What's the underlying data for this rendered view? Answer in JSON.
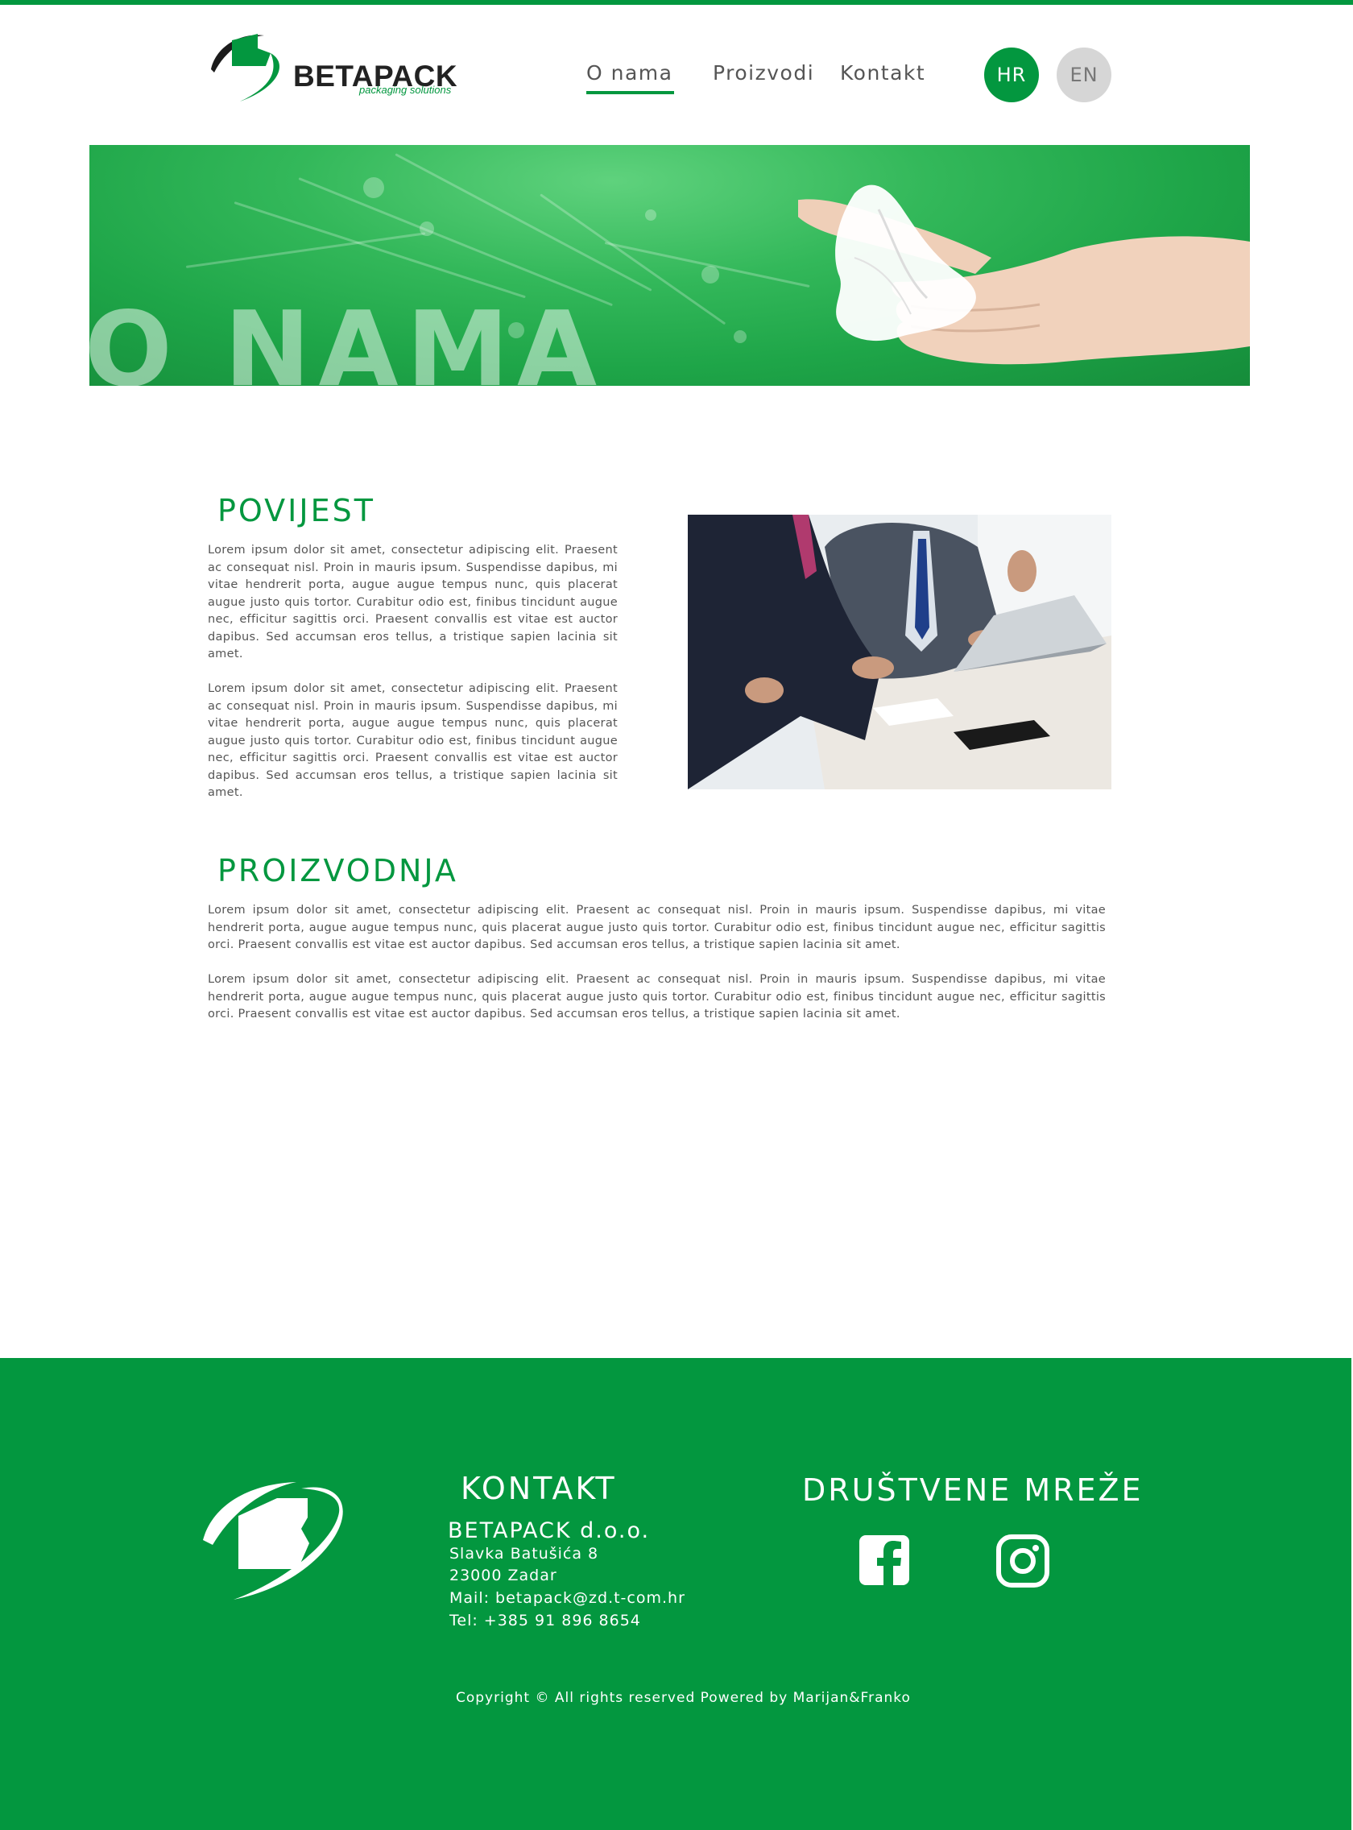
{
  "brand": {
    "name": "BETAPACK",
    "tagline": "packaging solutions"
  },
  "nav": {
    "items": [
      {
        "label": "O nama",
        "active": true
      },
      {
        "label": "Proizvodi",
        "active": false
      },
      {
        "label": "Kontakt",
        "active": false
      }
    ],
    "languages": [
      {
        "label": "HR",
        "active": true
      },
      {
        "label": "EN",
        "active": false
      }
    ]
  },
  "hero": {
    "title": "O NAMA"
  },
  "sections": {
    "povijest": {
      "title": "POVIJEST",
      "paragraphs": [
        "Lorem ipsum dolor sit amet, consectetur adipiscing elit. Praesent ac consequat nisl. Proin in mauris ipsum. Suspendisse dapibus, mi vitae hendrerit porta, augue augue tempus nunc, quis placerat augue justo quis tortor. Curabitur odio est, finibus tincidunt augue nec, efficitur sagittis orci. Praesent convallis est vitae est auctor dapibus. Sed accumsan eros tellus, a tristique sapien lacinia sit amet.",
        "Lorem ipsum dolor sit amet, consectetur adipiscing elit. Praesent ac consequat nisl. Proin in mauris ipsum. Suspendisse dapibus, mi vitae hendrerit porta, augue augue tempus nunc, quis placerat augue justo quis tortor. Curabitur odio est, finibus tincidunt augue nec, efficitur sagittis orci. Praesent convallis est vitae est auctor dapibus. Sed accumsan eros tellus, a tristique sapien lacinia sit amet."
      ]
    },
    "proizvodnja": {
      "title": "PROIZVODNJA",
      "paragraphs": [
        "Lorem ipsum dolor sit amet, consectetur adipiscing elit. Praesent ac consequat nisl. Proin in mauris ipsum. Suspendisse dapibus, mi vitae hendrerit porta, augue augue tempus nunc, quis placerat augue justo quis tortor. Curabitur odio est, finibus tincidunt augue nec, efficitur sagittis orci. Praesent convallis est vitae est auctor dapibus. Sed accumsan eros tellus, a tristique sapien lacinia sit amet.",
        "Lorem ipsum dolor sit amet, consectetur adipiscing elit. Praesent ac consequat nisl. Proin in mauris ipsum. Suspendisse dapibus, mi vitae hendrerit porta, augue augue tempus nunc, quis placerat augue justo quis tortor. Curabitur odio est, finibus tincidunt augue nec, efficitur sagittis orci. Praesent convallis est vitae est auctor dapibus. Sed accumsan eros tellus, a tristique sapien lacinia sit amet."
      ]
    }
  },
  "footer": {
    "contact_title": "KONTAKT",
    "company": "BETAPACK d.o.o.",
    "address_street": "Slavka Batušića 8",
    "address_city": "23000 Zadar",
    "mail": "Mail: betapack@zd.t-com.hr",
    "tel": "Tel: +385 91 896 8654",
    "social_title": "DRUŠTVENE MREŽE",
    "social_icons": [
      "facebook-icon",
      "instagram-icon"
    ],
    "copyright": "Copyright © All rights reserved Powered by Marijan&Franko"
  },
  "colors": {
    "brand_green": "#03973f",
    "lang_inactive": "#d6d6d6",
    "text": "#555555"
  }
}
